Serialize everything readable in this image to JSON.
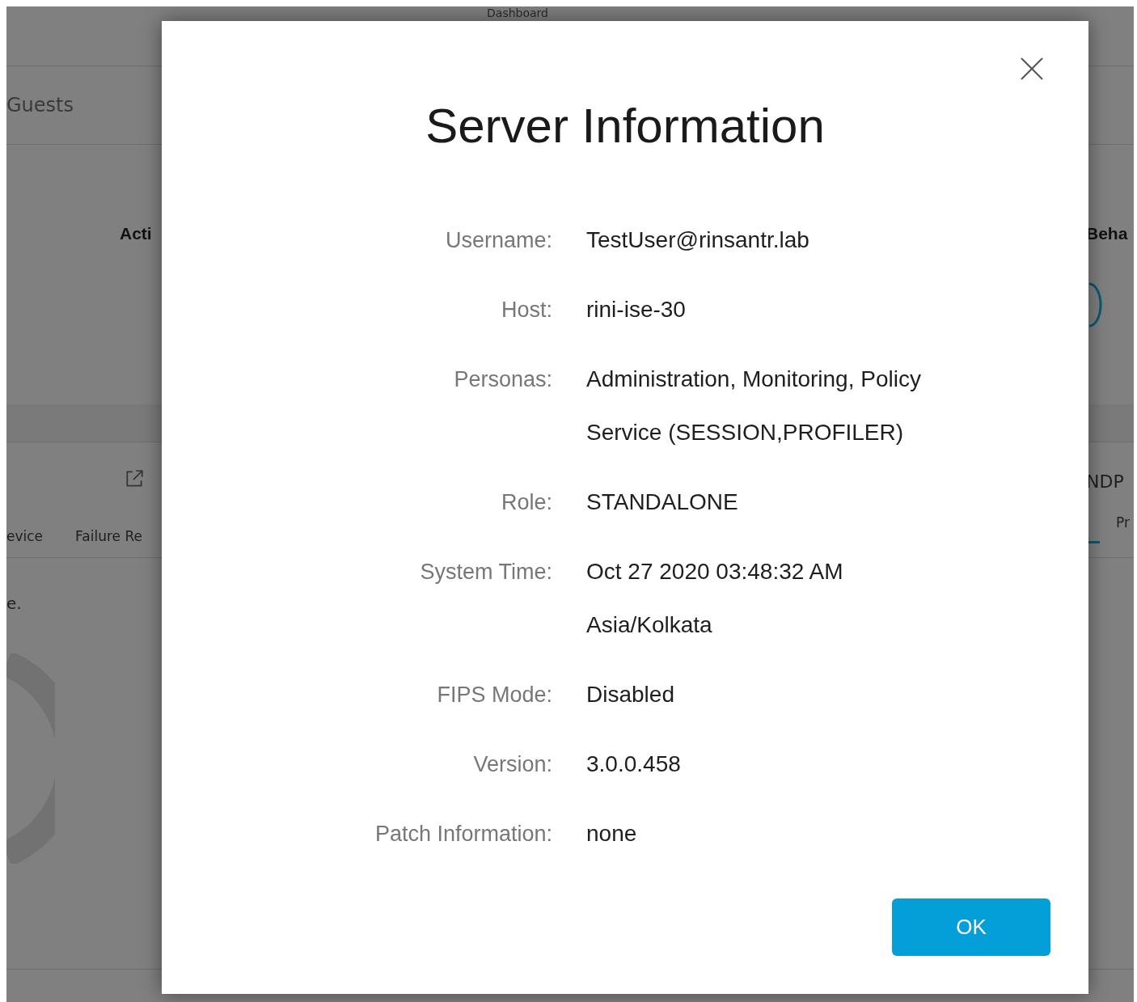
{
  "background": {
    "header_title": "Dashboard",
    "tab": "Guests",
    "left_heading": "Acti",
    "right_heading": "Beha",
    "right_tab_title": "NDP",
    "left_columns": [
      "evice",
      "Failure Re"
    ],
    "right_column": "Pr",
    "left_text": "e."
  },
  "dialog": {
    "title": "Server Information",
    "fields": [
      {
        "label": "Username:",
        "value": "TestUser@rinsantr.lab"
      },
      {
        "label": "Host:",
        "value": "rini-ise-30"
      },
      {
        "label": "Personas:",
        "value": "Administration, Monitoring, Policy Service (SESSION,PROFILER)"
      },
      {
        "label": "Role:",
        "value": "STANDALONE"
      },
      {
        "label": "System Time:",
        "value": "Oct 27 2020 03:48:32 AM Asia/Kolkata"
      },
      {
        "label": "FIPS Mode:",
        "value": "Disabled"
      },
      {
        "label": "Version:",
        "value": "3.0.0.458"
      },
      {
        "label": "Patch Information:",
        "value": "none"
      }
    ],
    "button": "OK"
  }
}
